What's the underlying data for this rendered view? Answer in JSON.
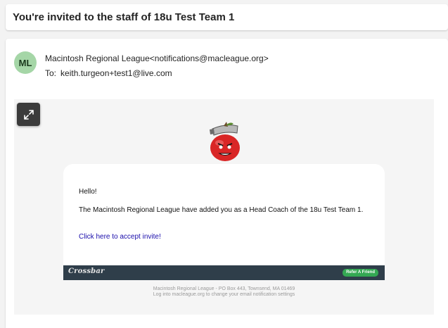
{
  "subject": "You're invited to the staff of 18u Test Team 1",
  "sender": {
    "initials": "ML",
    "avatar_color": "#a5d6a7",
    "name": "Macintosh Regional League",
    "email": "<notifications@macleague.org>"
  },
  "recipient": {
    "label": "To:",
    "email": "keith.turgeon+test1@live.com"
  },
  "body": {
    "expand_icon": "expand-icon",
    "logo_icon": "apple-mascot-logo",
    "greeting": "Hello!",
    "message": "The Macintosh Regional League have added you as a Head Coach of the 18u Test Team 1.",
    "link_text": "Click here to accept invite!",
    "footer": {
      "brand": "Crossbar",
      "bar_color": "#2f3e4a",
      "refer_button": "Refer A Friend",
      "refer_color": "#34a853"
    },
    "address_line": "Macintosh Regional League - PO Box 443, Townsend, MA 01469",
    "settings_line": "Log into macleague.org to change your email notification settings"
  }
}
